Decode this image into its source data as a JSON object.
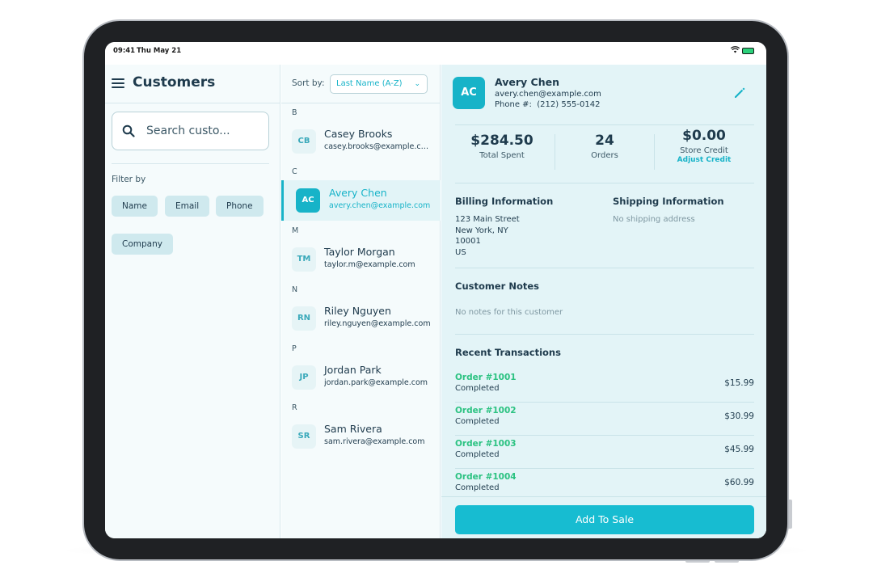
{
  "status_bar": {
    "time": "09:41",
    "date": "Thu May 21"
  },
  "sidebar": {
    "title": "Customers",
    "search_placeholder": "Search custo...",
    "filter_label": "Filter by",
    "filters": [
      "Name",
      "Email",
      "Phone",
      "Company"
    ]
  },
  "list": {
    "sort_label": "Sort by:",
    "sort_value": "Last Name (A-Z)",
    "sections": [
      {
        "letter": "B",
        "customers": [
          {
            "initials": "CB",
            "name": "Casey Brooks",
            "email": "casey.brooks@example.com"
          }
        ]
      },
      {
        "letter": "C",
        "customers": [
          {
            "initials": "AC",
            "name": "Avery Chen",
            "email": "avery.chen@example.com"
          }
        ]
      },
      {
        "letter": "M",
        "customers": [
          {
            "initials": "TM",
            "name": "Taylor Morgan",
            "email": "taylor.m@example.com"
          }
        ]
      },
      {
        "letter": "N",
        "customers": [
          {
            "initials": "RN",
            "name": "Riley Nguyen",
            "email": "riley.nguyen@example.com"
          }
        ]
      },
      {
        "letter": "P",
        "customers": [
          {
            "initials": "JP",
            "name": "Jordan Park",
            "email": "jordan.park@example.com"
          }
        ]
      },
      {
        "letter": "R",
        "customers": [
          {
            "initials": "SR",
            "name": "Sam Rivera",
            "email": "sam.rivera@example.com"
          }
        ]
      }
    ]
  },
  "detail": {
    "initials": "AC",
    "name": "Avery Chen",
    "email": "avery.chen@example.com",
    "phone": "Phone #:  (212) 555-0142",
    "stats": {
      "total_spent": "$284.50",
      "total_spent_label": "Total Spent",
      "orders": "24",
      "orders_label": "Orders",
      "store_credit": "$0.00",
      "store_credit_label": "Store Credit",
      "adjust_credit": "Adjust Credit"
    },
    "billing_title": "Billing Information",
    "billing_lines": [
      "123 Main Street",
      "New York, NY",
      "10001",
      "US"
    ],
    "shipping_title": "Shipping Information",
    "shipping_text": "No shipping address",
    "notes_title": "Customer Notes",
    "notes_text": "No notes for this customer",
    "transactions_title": "Recent Transactions",
    "transactions": [
      {
        "id": "Order #1001",
        "status": "Completed",
        "amount": "$15.99"
      },
      {
        "id": "Order #1002",
        "status": "Completed",
        "amount": "$30.99"
      },
      {
        "id": "Order #1003",
        "status": "Completed",
        "amount": "$45.99"
      },
      {
        "id": "Order #1004",
        "status": "Completed",
        "amount": "$60.99"
      }
    ],
    "add_button": "Add To Sale"
  },
  "colors": {
    "accent": "#17b3c8",
    "order_green": "#2bc281",
    "panel_bg": "#e3f4f7"
  }
}
